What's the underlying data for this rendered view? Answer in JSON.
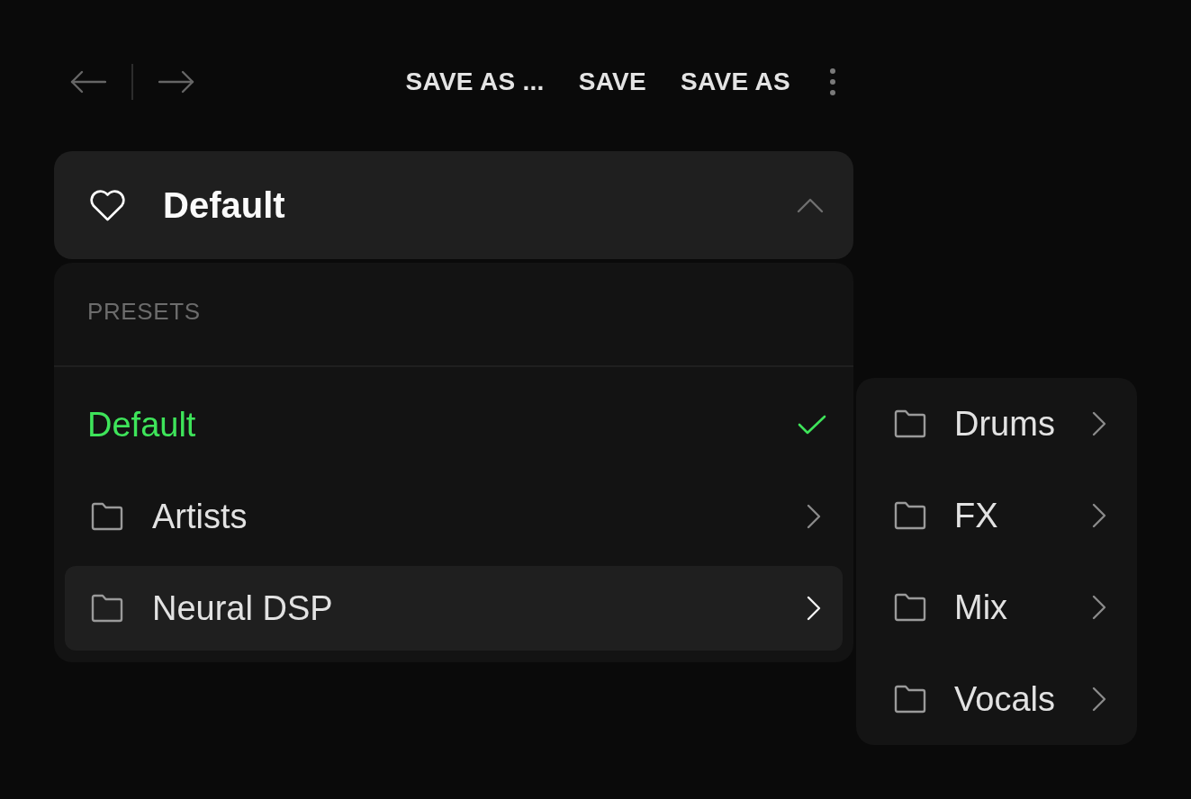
{
  "toolbar": {
    "nav": [
      {
        "kind": "back",
        "disabled": true
      },
      {
        "kind": "forward",
        "disabled": true
      }
    ],
    "actions": [
      "SAVE AS ...",
      "SAVE",
      "SAVE AS"
    ]
  },
  "preset_selector": {
    "title": "Default",
    "favorite": false,
    "expanded": true
  },
  "dropdown": {
    "heading": "PRESETS",
    "items": [
      {
        "kind": "preset",
        "label": "Default",
        "selected": true,
        "open": false
      },
      {
        "kind": "folder",
        "label": "Artists",
        "selected": false,
        "open": false
      },
      {
        "kind": "folder",
        "label": "Neural DSP",
        "selected": false,
        "open": true,
        "children": [
          {
            "kind": "folder",
            "label": "Drums"
          },
          {
            "kind": "folder",
            "label": "FX"
          },
          {
            "kind": "folder",
            "label": "Mix"
          },
          {
            "kind": "folder",
            "label": "Vocals"
          }
        ]
      }
    ]
  }
}
